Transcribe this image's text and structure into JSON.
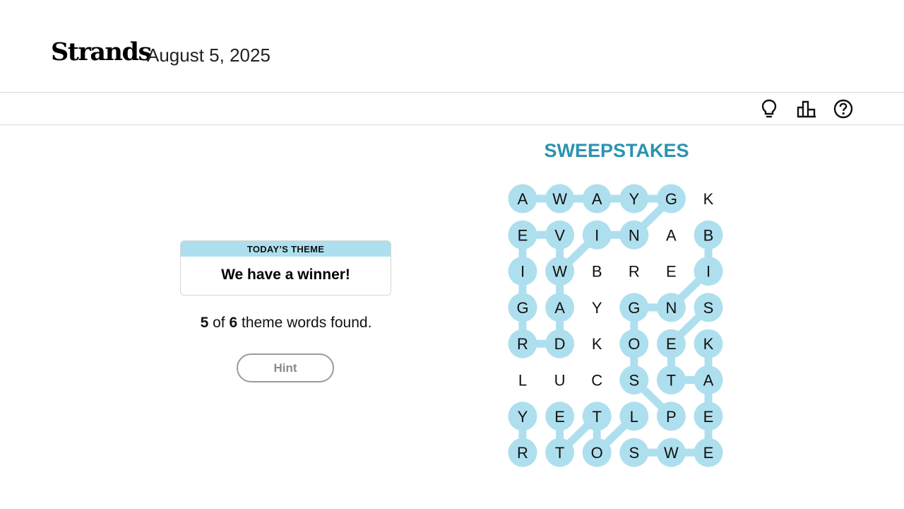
{
  "header": {
    "title": "Strands",
    "date": "August 5, 2025"
  },
  "toolbar": {
    "icons": [
      "lightbulb-icon",
      "bar-chart-icon",
      "help-circle-icon"
    ]
  },
  "theme": {
    "label": "TODAY’S THEME",
    "text": "We have a winner!"
  },
  "progress": {
    "found": "5",
    "of_text": "of",
    "total": "6",
    "suffix": "theme words found."
  },
  "hint": {
    "label": "Hint"
  },
  "spangram": "SWEEPSTAKES",
  "colors": {
    "highlight": "#aedfee",
    "spangram": "#2b93b0",
    "accent_text": "#111111"
  },
  "board": {
    "rows": [
      [
        "A",
        "W",
        "A",
        "Y",
        "G",
        "K"
      ],
      [
        "E",
        "V",
        "I",
        "N",
        "A",
        "B"
      ],
      [
        "I",
        "W",
        "B",
        "R",
        "E",
        "I"
      ],
      [
        "G",
        "A",
        "Y",
        "G",
        "N",
        "S"
      ],
      [
        "R",
        "D",
        "K",
        "O",
        "E",
        "K"
      ],
      [
        "L",
        "U",
        "C",
        "S",
        "T",
        "A"
      ],
      [
        "Y",
        "E",
        "T",
        "L",
        "P",
        "E"
      ],
      [
        "R",
        "T",
        "O",
        "S",
        "W",
        "E"
      ]
    ],
    "highlighted": [
      [
        true,
        true,
        true,
        true,
        true,
        false
      ],
      [
        true,
        true,
        true,
        true,
        false,
        true
      ],
      [
        true,
        true,
        false,
        false,
        false,
        true
      ],
      [
        true,
        true,
        false,
        true,
        true,
        true
      ],
      [
        true,
        true,
        false,
        true,
        true,
        true
      ],
      [
        false,
        false,
        false,
        true,
        true,
        true
      ],
      [
        true,
        true,
        true,
        true,
        true,
        true
      ],
      [
        true,
        true,
        true,
        true,
        true,
        true
      ]
    ],
    "found_paths": [
      [
        [
          0,
          0
        ],
        [
          0,
          1
        ],
        [
          0,
          2
        ],
        [
          0,
          3
        ],
        [
          0,
          4
        ],
        [
          1,
          3
        ],
        [
          1,
          2
        ],
        [
          2,
          1
        ],
        [
          3,
          1
        ],
        [
          4,
          1
        ],
        [
          4,
          0
        ],
        [
          3,
          0
        ],
        [
          2,
          0
        ],
        [
          1,
          0
        ],
        [
          1,
          1
        ],
        [
          2,
          1
        ]
      ],
      [
        [
          1,
          5
        ],
        [
          2,
          5
        ],
        [
          3,
          4
        ],
        [
          3,
          3
        ],
        [
          4,
          3
        ],
        [
          5,
          3
        ],
        [
          6,
          4
        ]
      ],
      [
        [
          3,
          5
        ],
        [
          4,
          4
        ],
        [
          5,
          4
        ],
        [
          5,
          5
        ],
        [
          4,
          5
        ]
      ],
      [
        [
          5,
          5
        ],
        [
          6,
          5
        ],
        [
          7,
          5
        ],
        [
          7,
          4
        ],
        [
          7,
          3
        ]
      ],
      [
        [
          6,
          0
        ],
        [
          7,
          0
        ]
      ],
      [
        [
          6,
          1
        ],
        [
          7,
          1
        ],
        [
          6,
          2
        ],
        [
          7,
          2
        ],
        [
          6,
          3
        ]
      ]
    ]
  }
}
